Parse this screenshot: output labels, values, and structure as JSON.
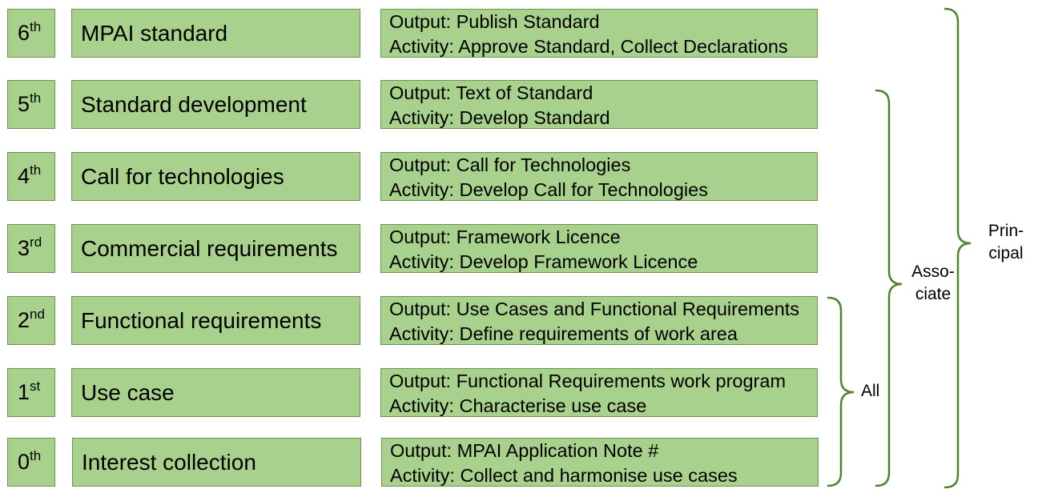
{
  "stages": [
    {
      "ordinal": "6",
      "suffix": "th",
      "name": "MPAI standard",
      "output": "Output: Publish Standard",
      "activity": "Activity: Approve Standard, Collect Declarations"
    },
    {
      "ordinal": "5",
      "suffix": "th",
      "name": "Standard development",
      "output": "Output: Text of Standard",
      "activity": "Activity: Develop Standard"
    },
    {
      "ordinal": "4",
      "suffix": "th",
      "name": "Call for technologies",
      "output": "Output: Call for Technologies",
      "activity": "Activity: Develop Call for Technologies"
    },
    {
      "ordinal": "3",
      "suffix": "rd",
      "name": "Commercial requirements",
      "output": "Output: Framework Licence",
      "activity": "Activity: Develop Framework Licence"
    },
    {
      "ordinal": "2",
      "suffix": "nd",
      "name": "Functional requirements",
      "output": "Output: Use Cases and Functional Requirements",
      "activity": "Activity: Define requirements of work area"
    },
    {
      "ordinal": "1",
      "suffix": "st",
      "name": "Use case",
      "output": "Output: Functional Requirements work program",
      "activity": "Activity: Characterise use case"
    },
    {
      "ordinal": "0",
      "suffix": "th",
      "name": "Interest collection",
      "output": "Output: MPAI Application Note #",
      "activity": "Activity: Collect and harmonise use cases"
    }
  ],
  "braces": {
    "all": "All",
    "associate_line1": "Asso-",
    "associate_line2": "ciate",
    "principal_line1": "Prin-",
    "principal_line2": "cipal"
  },
  "colors": {
    "box_fill": "#a9d18e",
    "box_border": "#6e9150",
    "brace": "#548235"
  }
}
